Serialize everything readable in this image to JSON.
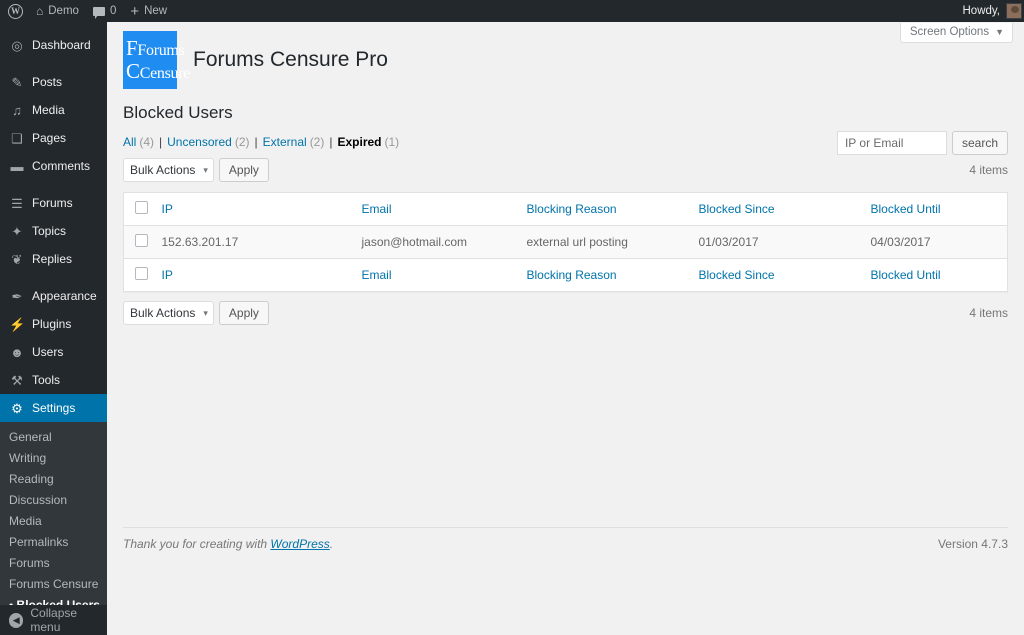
{
  "adminbar": {
    "site_name": "Demo",
    "comment_count": "0",
    "new_label": "New",
    "howdy": "Howdy,",
    "wp_logo_glyph": "W"
  },
  "screen_options": {
    "label": "Screen Options"
  },
  "sidebar": {
    "items": [
      {
        "label": "Dashboard",
        "icon": "dashboard-icon",
        "glyph": "◎",
        "name": "dashboard"
      },
      {
        "label": "Posts",
        "icon": "pin-icon",
        "glyph": "✎",
        "name": "posts"
      },
      {
        "label": "Media",
        "icon": "media-icon",
        "glyph": "♫",
        "name": "media"
      },
      {
        "label": "Pages",
        "icon": "page-icon",
        "glyph": "❏",
        "name": "pages"
      },
      {
        "label": "Comments",
        "icon": "comment-icon",
        "glyph": "▬",
        "name": "comments"
      },
      {
        "label": "Forums",
        "icon": "forums-icon",
        "glyph": "☰",
        "name": "forums"
      },
      {
        "label": "Topics",
        "icon": "topics-icon",
        "glyph": "✦",
        "name": "topics"
      },
      {
        "label": "Replies",
        "icon": "replies-icon",
        "glyph": "❦",
        "name": "replies"
      },
      {
        "label": "Appearance",
        "icon": "brush-icon",
        "glyph": "✒",
        "name": "appearance"
      },
      {
        "label": "Plugins",
        "icon": "plug-icon",
        "glyph": "⚡",
        "name": "plugins"
      },
      {
        "label": "Users",
        "icon": "user-icon",
        "glyph": "☻",
        "name": "users"
      },
      {
        "label": "Tools",
        "icon": "wrench-icon",
        "glyph": "⚒",
        "name": "tools"
      },
      {
        "label": "Settings",
        "icon": "settings-icon",
        "glyph": "⚙",
        "name": "settings"
      }
    ],
    "submenu": [
      {
        "label": "General",
        "active": false
      },
      {
        "label": "Writing",
        "active": false
      },
      {
        "label": "Reading",
        "active": false
      },
      {
        "label": "Discussion",
        "active": false
      },
      {
        "label": "Media",
        "active": false
      },
      {
        "label": "Permalinks",
        "active": false
      },
      {
        "label": "Forums",
        "active": false
      },
      {
        "label": "Forums Censure",
        "active": false
      },
      {
        "label": "Blocked Users",
        "active": true
      }
    ],
    "collapse_label": "Collapse menu"
  },
  "page": {
    "logo_line1": "Forums",
    "logo_line2": "Censure",
    "plugin_title": "Forums Censure Pro",
    "subtitle": "Blocked Users"
  },
  "filters": [
    {
      "label": "All",
      "count": "(4)",
      "current": false
    },
    {
      "label": "Uncensored",
      "count": "(2)",
      "current": false
    },
    {
      "label": "External",
      "count": "(2)",
      "current": false
    },
    {
      "label": "Expired",
      "count": "(1)",
      "current": true
    }
  ],
  "search": {
    "placeholder": "IP or Email",
    "value": "",
    "button_label": "search"
  },
  "tablenav": {
    "bulk_label": "Bulk Actions",
    "apply_label": "Apply",
    "items_label": "4 items",
    "caret": "▾"
  },
  "table": {
    "columns": [
      "IP",
      "Email",
      "Blocking Reason",
      "Blocked Since",
      "Blocked Until"
    ],
    "rows": [
      {
        "ip": "152.63.201.17",
        "email": "jason@hotmail.com",
        "reason": "external url posting",
        "since": "01/03/2017",
        "until": "04/03/2017"
      }
    ]
  },
  "footer": {
    "thanks_prefix": "Thank you for creating with ",
    "wordpress_link": "WordPress",
    "thanks_suffix": ".",
    "version": "Version 4.7.3"
  },
  "colors": {
    "admin_dark": "#23282d",
    "submenu_dark": "#32373c",
    "accent_blue": "#0073aa",
    "link_blue": "#0073aa",
    "logo_blue": "#1e8cf0",
    "page_bg": "#f1f1f1"
  }
}
